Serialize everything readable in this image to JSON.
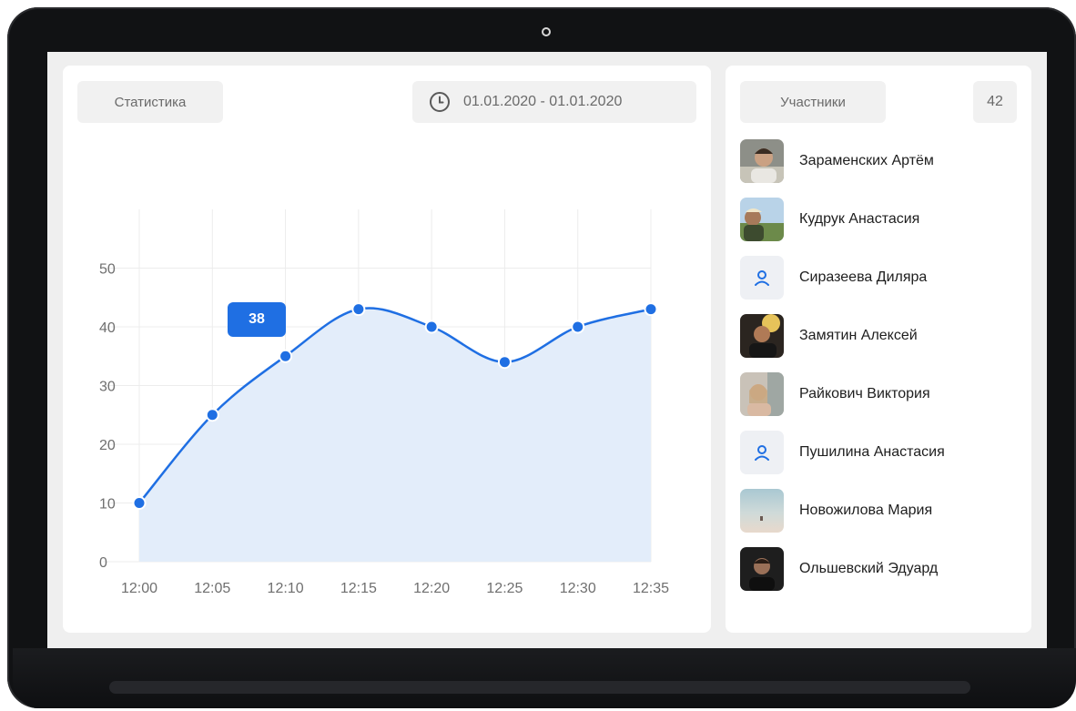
{
  "stats": {
    "title": "Статистика",
    "date_range": "01.01.2020 - 01.01.2020"
  },
  "members": {
    "title": "Участники",
    "count": "42",
    "items": [
      {
        "name": "Зараменских Артём",
        "avatar": "photo"
      },
      {
        "name": "Кудрук Анастасия",
        "avatar": "photo"
      },
      {
        "name": "Сиразеева Диляра",
        "avatar": "user-icon"
      },
      {
        "name": "Замятин Алексей",
        "avatar": "photo"
      },
      {
        "name": "Райкович Виктория",
        "avatar": "photo"
      },
      {
        "name": "Пушилина Анастасия",
        "avatar": "user-icon"
      },
      {
        "name": "Новожилова Мария",
        "avatar": "photo"
      },
      {
        "name": "Ольшевский Эдуард",
        "avatar": "photo"
      }
    ]
  },
  "chart_data": {
    "type": "area",
    "x": [
      "12:00",
      "12:05",
      "12:10",
      "12:15",
      "12:20",
      "12:25",
      "12:30",
      "12:35"
    ],
    "values": [
      10,
      25,
      35,
      43,
      40,
      34,
      40,
      43
    ],
    "yticks": [
      "0",
      "10",
      "20",
      "30",
      "40",
      "50"
    ],
    "ylim": [
      0,
      60
    ],
    "tooltip": {
      "label": "38",
      "category": "12:10"
    },
    "grid": true,
    "colors": {
      "line": "#1f6fe3",
      "fill": "#e3edfa",
      "grid": "#ececec"
    }
  }
}
